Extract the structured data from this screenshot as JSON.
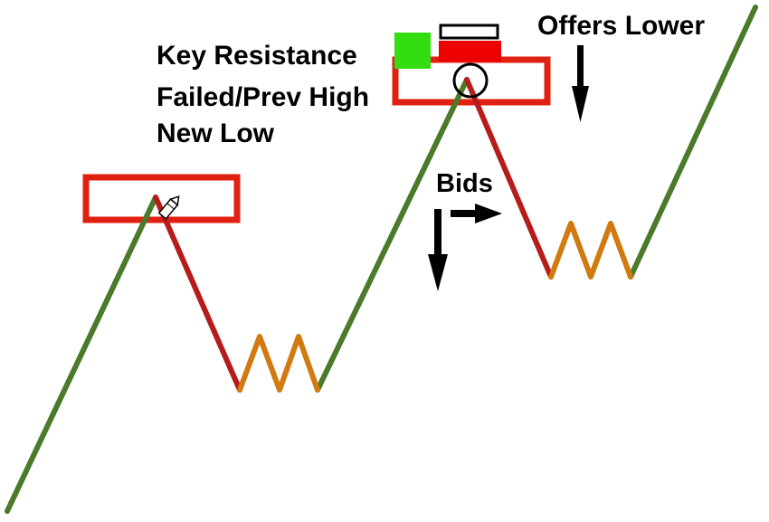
{
  "labels": {
    "key_resistance": "Key Resistance",
    "failed_prev_high": "Failed/Prev High",
    "new_low": "New Low",
    "offers_lower": "Offers Lower",
    "bids": "Bids"
  },
  "colors": {
    "uptrend": "#4a7a2a",
    "downtrend": "#b71c1c",
    "consolidation": "#d07a10",
    "resistance_box": "#e02010",
    "indicator_green": "#33dd11",
    "indicator_red": "#ee0000",
    "arrow": "#000000"
  },
  "icons": {
    "cursor": "pencil-cursor-icon",
    "high_marker": "circle-marker-icon"
  }
}
